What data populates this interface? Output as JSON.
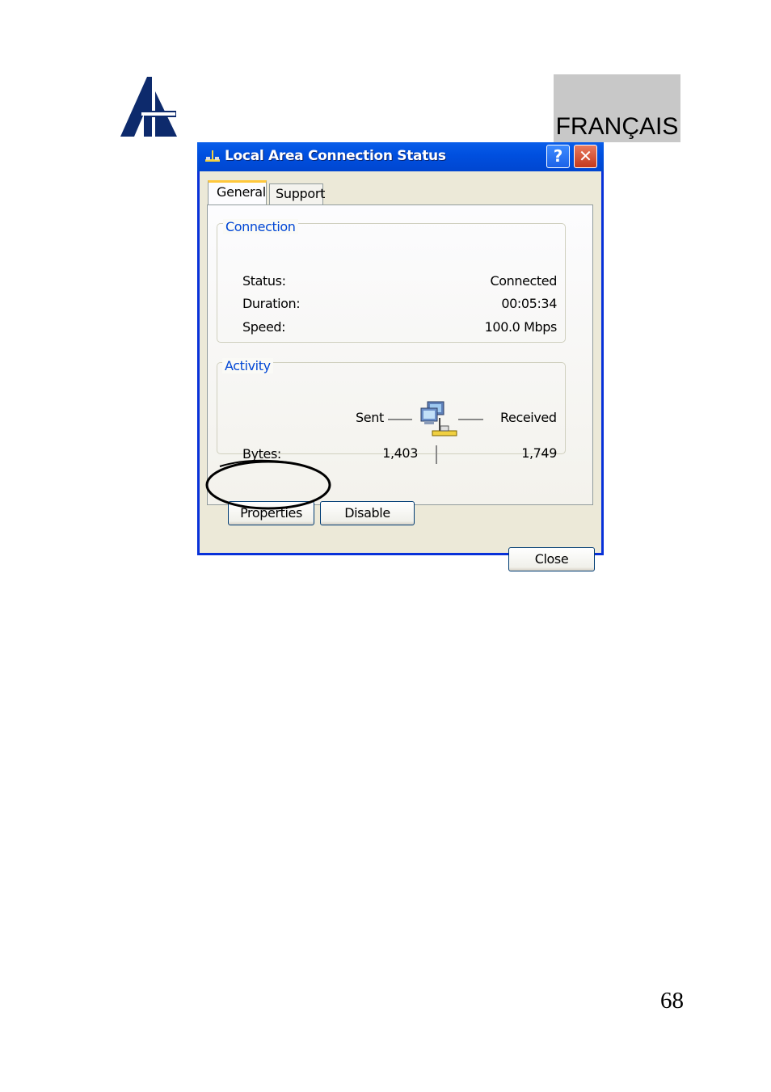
{
  "header": {
    "language_label": "FRANÇAIS"
  },
  "footer": {
    "page_number": "68"
  },
  "window": {
    "title": "Local Area Connection Status",
    "help_label": "?",
    "close_glyph": "✕"
  },
  "tabs": [
    {
      "label": "General",
      "selected": true
    },
    {
      "label": "Support",
      "selected": false
    }
  ],
  "connection": {
    "group_title": "Connection",
    "rows": [
      {
        "label": "Status:",
        "value": "Connected"
      },
      {
        "label": "Duration:",
        "value": "00:05:34"
      },
      {
        "label": "Speed:",
        "value": "100.0 Mbps"
      }
    ]
  },
  "activity": {
    "group_title": "Activity",
    "sent_label": "Sent",
    "received_label": "Received",
    "bytes_label": "Bytes:",
    "bytes_sent": "1,403",
    "bytes_received": "1,749",
    "icon": "network-computers-icon"
  },
  "buttons": {
    "properties": "Properties",
    "disable": "Disable",
    "close": "Close"
  },
  "colors": {
    "titlebar": "#0054e3",
    "group_title": "#0046d5",
    "window_bg": "#ece9d8",
    "tab_highlight": "#ffc83c"
  }
}
